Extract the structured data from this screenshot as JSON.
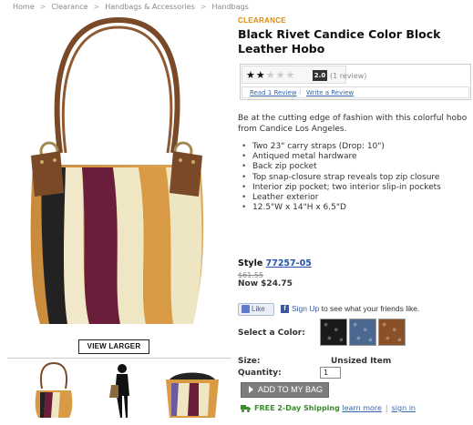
{
  "breadcrumb": [
    "Home",
    "Clearance",
    "Handbags & Accessories",
    "Handbags"
  ],
  "product": {
    "badge": "CLEARANCE",
    "title": "Black Rivet Candice Color Block Leather Hobo",
    "rating": 2.0,
    "rating_label": "2.0",
    "review_count": "(1 review)",
    "read_reviews": "Read 1 Review",
    "write_review": "Write a Review",
    "description": "Be at the cutting edge of fashion with this colorful hobo from Candice Los Angeles.",
    "features": [
      "Two 23\" carry straps (Drop: 10\")",
      "Antiqued metal hardware",
      "Back zip pocket",
      "Top snap-closure strap reveals top zip closure",
      "Interior zip pocket; two interior slip-in pockets",
      "Leather exterior",
      "12.5\"W x 14\"H x 6.5\"D"
    ],
    "style_label": "Style",
    "style_number": "77257-05",
    "was_price": "$61.55",
    "now_price": "Now $24.75"
  },
  "social": {
    "like_label": "Like",
    "signup_link": "Sign Up",
    "signup_text": " to see what your friends like."
  },
  "purchase": {
    "color_label": "Select a Color:",
    "swatch_colors": [
      "#1a1a1a",
      "#4a6890",
      "#8a5128"
    ],
    "size_label": "Size:",
    "size_value": "Unsized Item",
    "qty_label": "Quantity:",
    "qty_value": "1",
    "add_to_bag": "ADD TO MY BAG"
  },
  "shipping": {
    "text": "FREE 2-Day Shipping",
    "learn_more": "learn more",
    "sign_in": "sign in"
  },
  "media": {
    "view_larger": "VIEW LARGER"
  },
  "colors": {
    "accent_orange": "#e08a00",
    "link_blue": "#3366aa",
    "ship_green": "#3c8a2e"
  }
}
